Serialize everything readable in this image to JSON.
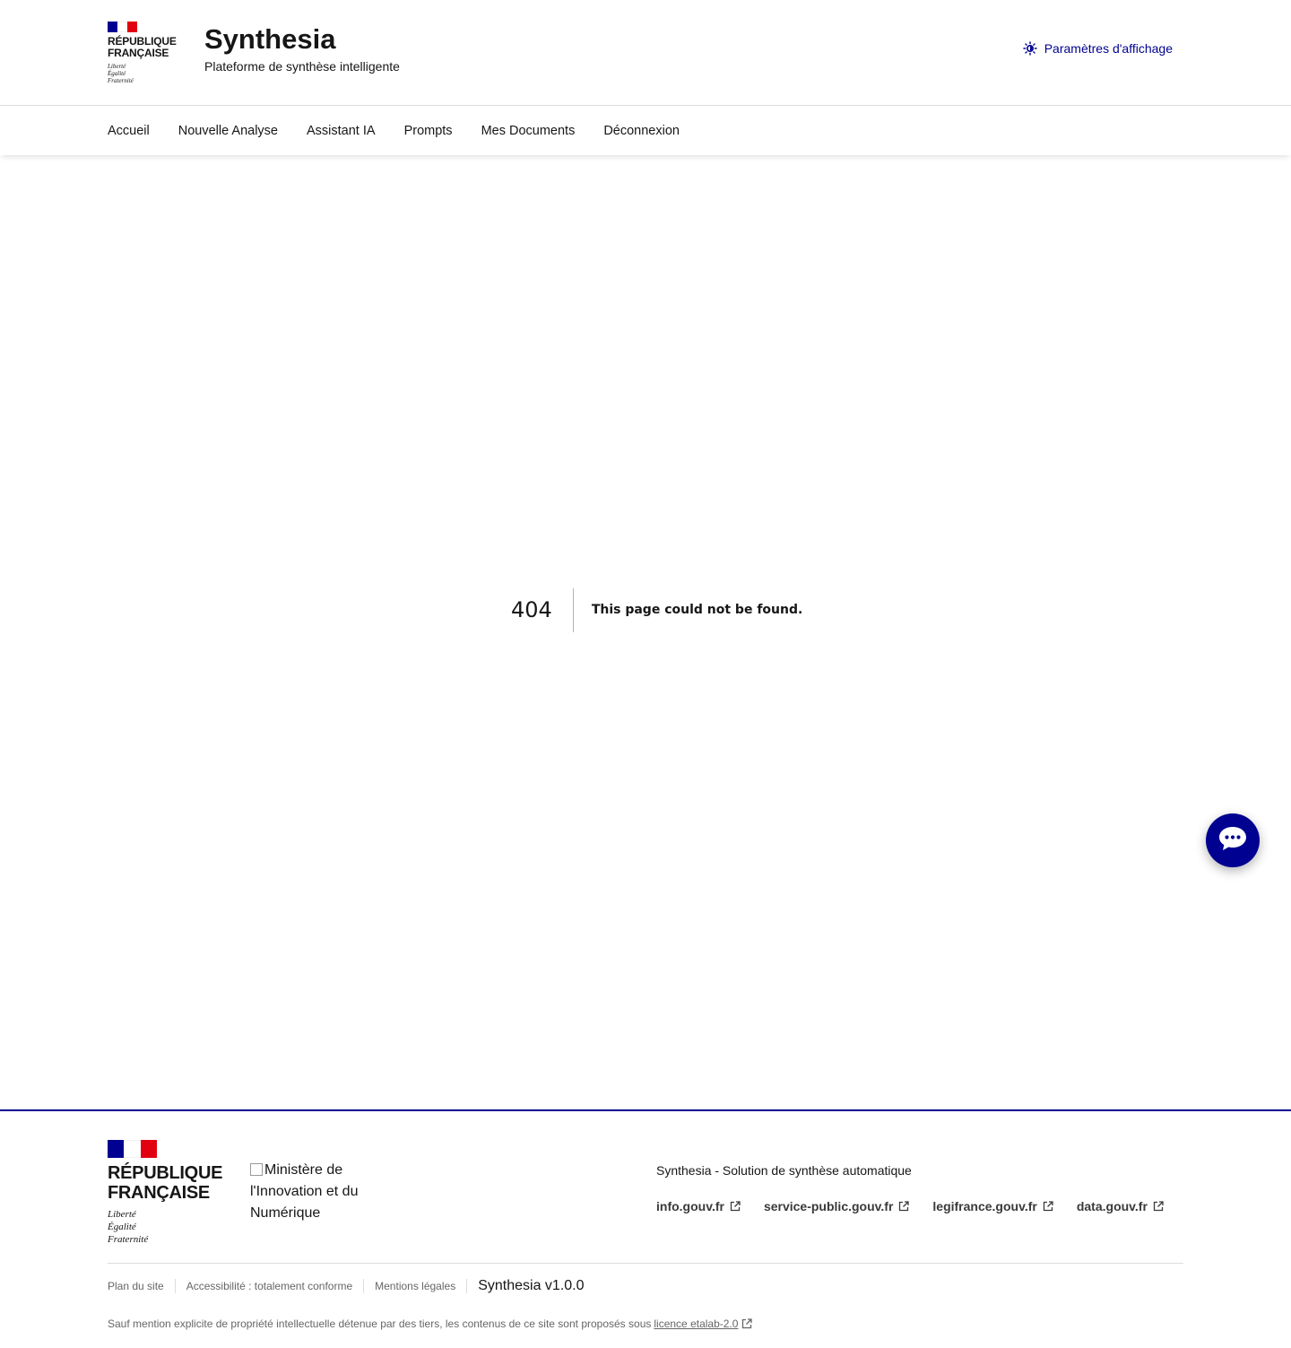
{
  "brand": {
    "republic": [
      "RÉPUBLIQUE",
      "FRANÇAISE"
    ],
    "motto": [
      "Liberté",
      "Égalité",
      "Fraternité"
    ],
    "colors": {
      "blue": "#000091",
      "red": "#e1000f"
    }
  },
  "header": {
    "service_title": "Synthesia",
    "service_tagline": "Plateforme de synthèse intelligente",
    "display_settings_label": "Paramètres d'affichage",
    "display_settings_icon": "theme-sun-icon"
  },
  "nav": {
    "items": [
      {
        "label": "Accueil"
      },
      {
        "label": "Nouvelle Analyse"
      },
      {
        "label": "Assistant IA"
      },
      {
        "label": "Prompts"
      },
      {
        "label": "Mes Documents"
      },
      {
        "label": "Déconnexion"
      }
    ]
  },
  "error": {
    "code": "404",
    "message": "This page could not be found."
  },
  "chat": {
    "icon": "chat-bubble-icon"
  },
  "footer": {
    "ministry_alt": "Ministère de l'Innovation et du Numérique",
    "description": "Synthesia - Solution de synthèse automatique",
    "links": [
      {
        "label": "info.gouv.fr"
      },
      {
        "label": "service-public.gouv.fr"
      },
      {
        "label": "legifrance.gouv.fr"
      },
      {
        "label": "data.gouv.fr"
      }
    ],
    "bottom_links": [
      {
        "label": "Plan du site"
      },
      {
        "label": "Accessibilité : totalement conforme"
      },
      {
        "label": "Mentions légales"
      }
    ],
    "version": "Synthesia v1.0.0",
    "license_text": "Sauf mention explicite de propriété intellectuelle détenue par des tiers, les contenus de ce site sont proposés sous",
    "license_link": "licence etalab-2.0"
  }
}
